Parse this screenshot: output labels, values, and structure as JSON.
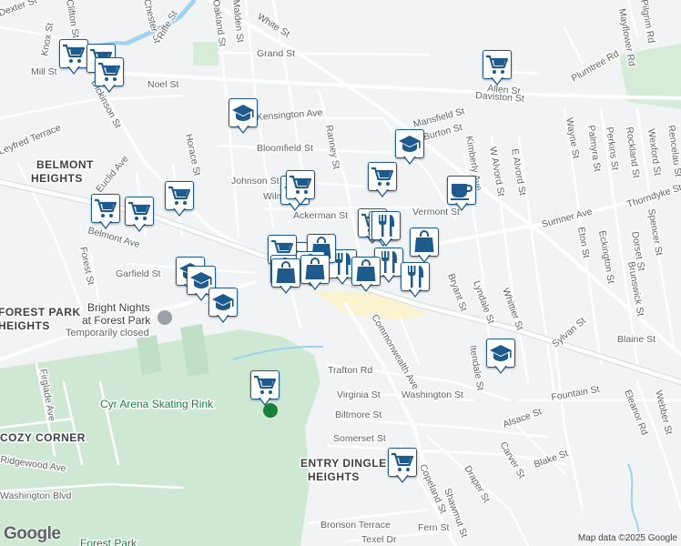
{
  "map": {
    "streets": [
      "White St",
      "Oakland St",
      "Malden St",
      "Grand St",
      "Clifton St",
      "Chester St",
      "Riffe St",
      "Knox St",
      "Mill St",
      "Noel St",
      "Allen St",
      "Daviston St",
      "Mayflower Rd",
      "Plumtree Rd",
      "Pilgrim Rd",
      "Wayne St",
      "Palmyra St",
      "Perkins St",
      "Rockland St",
      "Wexford St",
      "Rencelau St",
      "Kensington Ave",
      "Ranney St",
      "Mansfield St",
      "Burton St",
      "Bloomfield St",
      "Johnson St",
      "Wilmont St",
      "Ackerman St",
      "Vermont St",
      "Kimberly Ave",
      "W Alvord St",
      "E Alvord St",
      "Sumner Ave",
      "Thorndyke St",
      "Dorset St",
      "Eton St",
      "Eckington St",
      "Brunswick St",
      "Spencer St",
      "Dickinson St",
      "Leyfred Terrace",
      "Horace St",
      "Euclid Ave",
      "Belmont Ave",
      "Forest St",
      "Garfield St",
      "Bryant St",
      "Lyndale St",
      "Whittier St",
      "Itendale St",
      "Commonwealth Ave",
      "Trafton Rd",
      "Virginia St",
      "Washington St",
      "Biltmore St",
      "Somerset St",
      "Sylvan St",
      "Fountain St",
      "Alsace St",
      "Carver St",
      "Blake St",
      "Eleanor Rd",
      "Webber St",
      "Blaine St",
      "Draper St",
      "Shawmut St",
      "Fern St",
      "Bronson Terrace",
      "Texel Dr",
      "Washington Blvd",
      "Firglade Ave",
      "Ridgewood Ave",
      "Copeland St",
      "Dexter St"
    ],
    "areas": [
      "BELMONT",
      "HEIGHTS",
      "FOREST PARK",
      "HEIGHTS",
      "COZY CORNER",
      "ENTRY DINGLE",
      "HEIGHTS"
    ],
    "pois": {
      "bright_nights": "Bright Nights",
      "bright_nights_2": "at Forest Park",
      "bright_nights_status": "Temporarily closed",
      "cyr_arena": "Cyr Arena Skating Rink",
      "forest_park": "Forest Park"
    }
  },
  "pins": [
    {
      "icon": "cart"
    },
    {
      "icon": "cart"
    },
    {
      "icon": "cart"
    },
    {
      "icon": "cart"
    },
    {
      "icon": "school"
    },
    {
      "icon": "school"
    },
    {
      "icon": "cart"
    },
    {
      "icon": "cart"
    },
    {
      "icon": "cart"
    },
    {
      "icon": "school"
    },
    {
      "icon": "cart"
    },
    {
      "icon": "coffee"
    },
    {
      "icon": "cart"
    },
    {
      "icon": "cart"
    },
    {
      "icon": "cart"
    },
    {
      "icon": "school"
    },
    {
      "icon": "school"
    },
    {
      "icon": "school"
    },
    {
      "icon": "school"
    },
    {
      "icon": "restaurant"
    },
    {
      "icon": "cart"
    },
    {
      "icon": "shopping-bag"
    },
    {
      "icon": "restaurant"
    },
    {
      "icon": "shopping-bag"
    },
    {
      "icon": "shopping-bag"
    },
    {
      "icon": "shopping-bag"
    },
    {
      "icon": "restaurant"
    },
    {
      "icon": "shopping-bag"
    },
    {
      "icon": "shopping-bag"
    },
    {
      "icon": "shopping-bag"
    },
    {
      "icon": "restaurant"
    },
    {
      "icon": "school"
    },
    {
      "icon": "cart"
    },
    {
      "icon": "cart"
    }
  ],
  "attribution": "Map data ©2025 Google",
  "logo": "Google"
}
